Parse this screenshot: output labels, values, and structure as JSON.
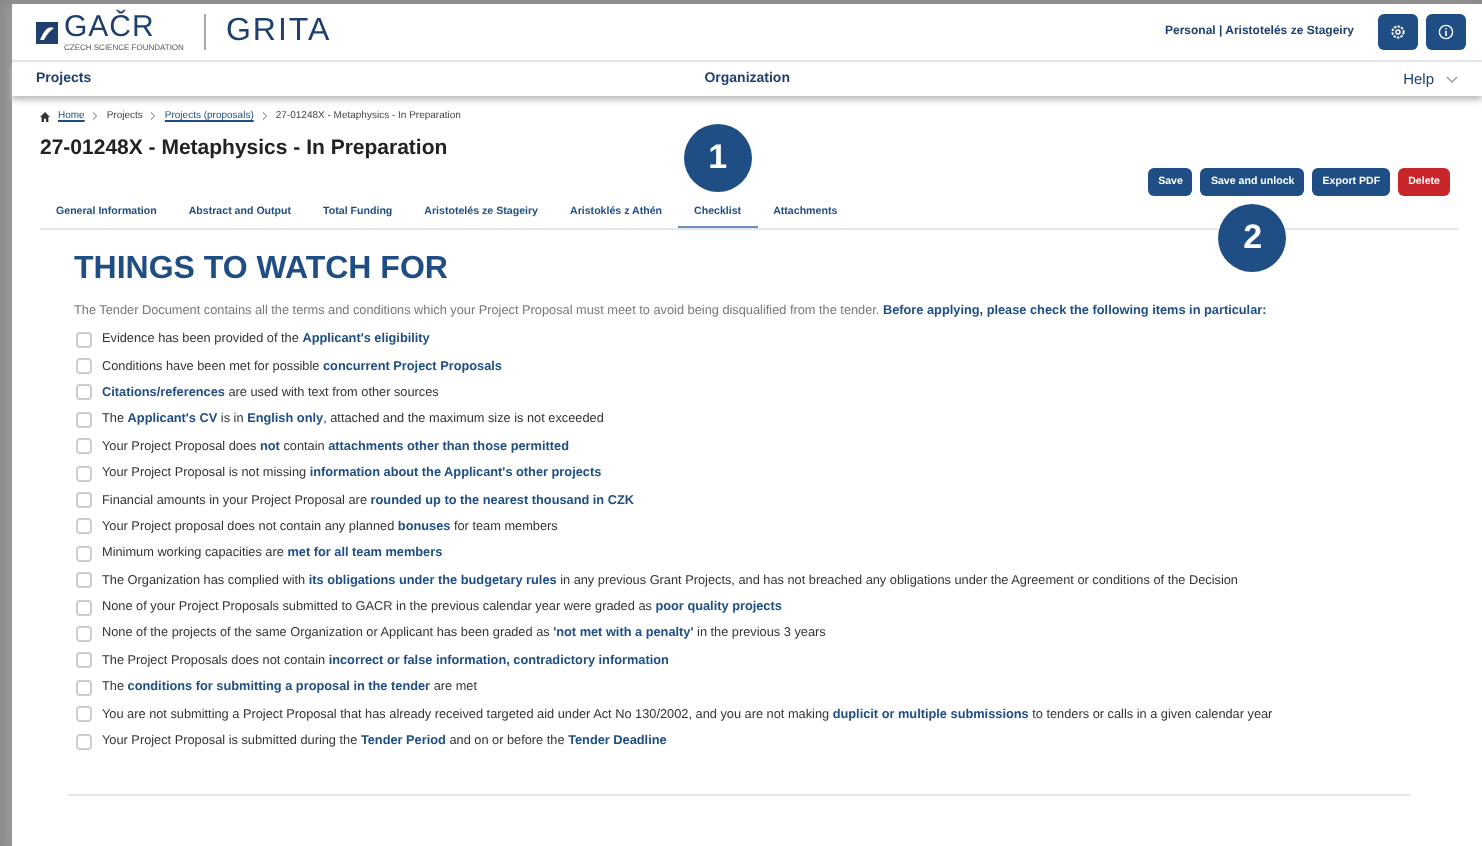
{
  "header": {
    "logo": "GAČR",
    "logo_subtitle": "CZECH SCIENCE FOUNDATION",
    "app_name": "GRITA",
    "user": "Personal | Aristotelés ze Stageiry"
  },
  "nav": {
    "left": "Projects",
    "center": "Organization",
    "right": "Help"
  },
  "breadcrumb": [
    {
      "label": "Home",
      "link": true
    },
    {
      "label": "Projects",
      "link": false
    },
    {
      "label": "Projects (proposals)",
      "link": true
    },
    {
      "label": "27-01248X - Metaphysics - In Preparation",
      "link": false
    }
  ],
  "title": "27-01248X - Metaphysics - In Preparation",
  "tabs": [
    {
      "label": "General Information",
      "selected": false
    },
    {
      "label": "Abstract and Output",
      "selected": false
    },
    {
      "label": "Total Funding",
      "selected": false
    },
    {
      "label": "Aristotelés ze Stageiry",
      "selected": false
    },
    {
      "label": "Aristoklés z Athén",
      "selected": false
    },
    {
      "label": "Checklist",
      "selected": true,
      "callout": "1"
    },
    {
      "label": "Attachments",
      "selected": false
    }
  ],
  "buttons": [
    {
      "label": "Save",
      "kind": "primary"
    },
    {
      "label": "Save and unlock",
      "kind": "primary",
      "callout": "2"
    },
    {
      "label": "Export PDF",
      "kind": "primary"
    },
    {
      "label": "Delete",
      "kind": "danger"
    }
  ],
  "heading": "THINGS TO WATCH FOR",
  "intro": "The Tender Document contains all the terms and conditions which your Project Proposal must meet to avoid being disqualified from the tender. **Before applying, please check the following items in particular:**",
  "items": [
    {
      "text": "Evidence has been provided of the **Applicant's eligibility**",
      "checked": false
    },
    {
      "text": "Conditions have been met for possible **concurrent Project Proposals**",
      "checked": false
    },
    {
      "text": "**Citations/references** are used with text from other sources",
      "checked": false
    },
    {
      "text": "The **Applicant's CV** is in **English only**, attached and the maximum size is not exceeded",
      "checked": false
    },
    {
      "text": "Your Project Proposal does **not** contain **attachments other than those permitted**",
      "checked": false
    },
    {
      "text": "Your Project Proposal is not missing **information about the Applicant's other projects**",
      "checked": false
    },
    {
      "text": "Financial amounts in your Project Proposal are **rounded up to the nearest thousand in CZK**",
      "checked": false
    },
    {
      "text": "Your Project proposal does not contain any planned **bonuses** for team members",
      "checked": false
    },
    {
      "text": "Minimum working capacities are **met for all team members**",
      "checked": false
    },
    {
      "text": "The Organization has complied with **its obligations under the budgetary rules** in any previous Grant Projects, and has not breached any obligations under the Agreement or conditions of the Decision",
      "checked": false
    },
    {
      "text": "None of your Project Proposals submitted to GACR in the previous calendar year were graded as **poor quality projects**",
      "checked": false
    },
    {
      "text": "None of the projects of the same Organization or Applicant has been graded as **'not met with a penalty'** in the previous 3 years",
      "checked": false
    },
    {
      "text": "The Project Proposals does not contain **incorrect or false information, contradictory information**",
      "checked": false
    },
    {
      "text": "The **conditions for submitting a proposal in the tender** are met",
      "checked": false
    },
    {
      "text": "You are not submitting a Project Proposal that has already received targeted aid under Act No 130/2002, and you are not making **duplicit or multiple submissions** to tenders or calls in a given calendar year",
      "checked": false
    },
    {
      "text": "Your Project Proposal is submitted during the **Tender Period** and on or before the **Tender Deadline**",
      "checked": false
    }
  ]
}
